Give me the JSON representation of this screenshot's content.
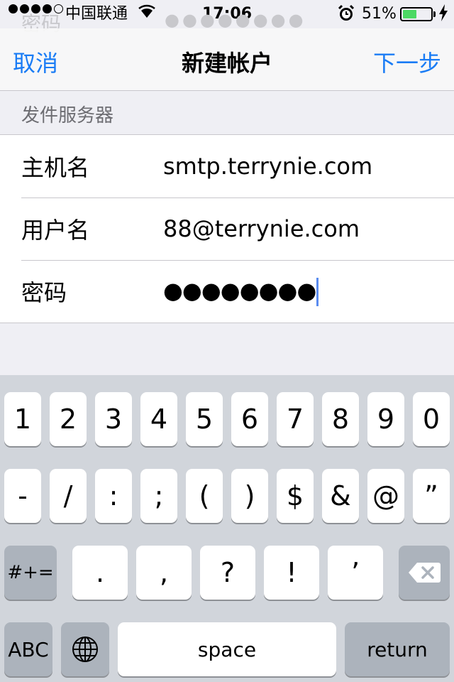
{
  "status_bar": {
    "carrier": "中国联通",
    "time": "17:06",
    "battery_percent": "51%",
    "battery_level": 0.51,
    "signal_bars_filled": 4,
    "signal_bars_total": 5
  },
  "background_ghost": {
    "label": "密码",
    "dots": "●●●●●●●●"
  },
  "nav": {
    "cancel": "取消",
    "title": "新建帐户",
    "next": "下一步"
  },
  "section": {
    "header": "发件服务器"
  },
  "form": {
    "host_label": "主机名",
    "host_value": "smtp.terrynie.com",
    "user_label": "用户名",
    "user_value": "88@terrynie.com",
    "password_label": "密码",
    "password_value": "●●●●●●●●"
  },
  "keyboard": {
    "row1": [
      "1",
      "2",
      "3",
      "4",
      "5",
      "6",
      "7",
      "8",
      "9",
      "0"
    ],
    "row2": [
      "-",
      "/",
      ":",
      ";",
      "(",
      ")",
      "$",
      "&",
      "@",
      "”"
    ],
    "row3": [
      ".",
      ",",
      "?",
      "!",
      "’"
    ],
    "symbols_key": "#+=",
    "abc_key": "ABC",
    "space_key": "space",
    "return_key": "return"
  },
  "colors": {
    "accent": "#1a7cf5",
    "battery": "#4cd964",
    "keyboard_bg": "#d1d5db"
  }
}
